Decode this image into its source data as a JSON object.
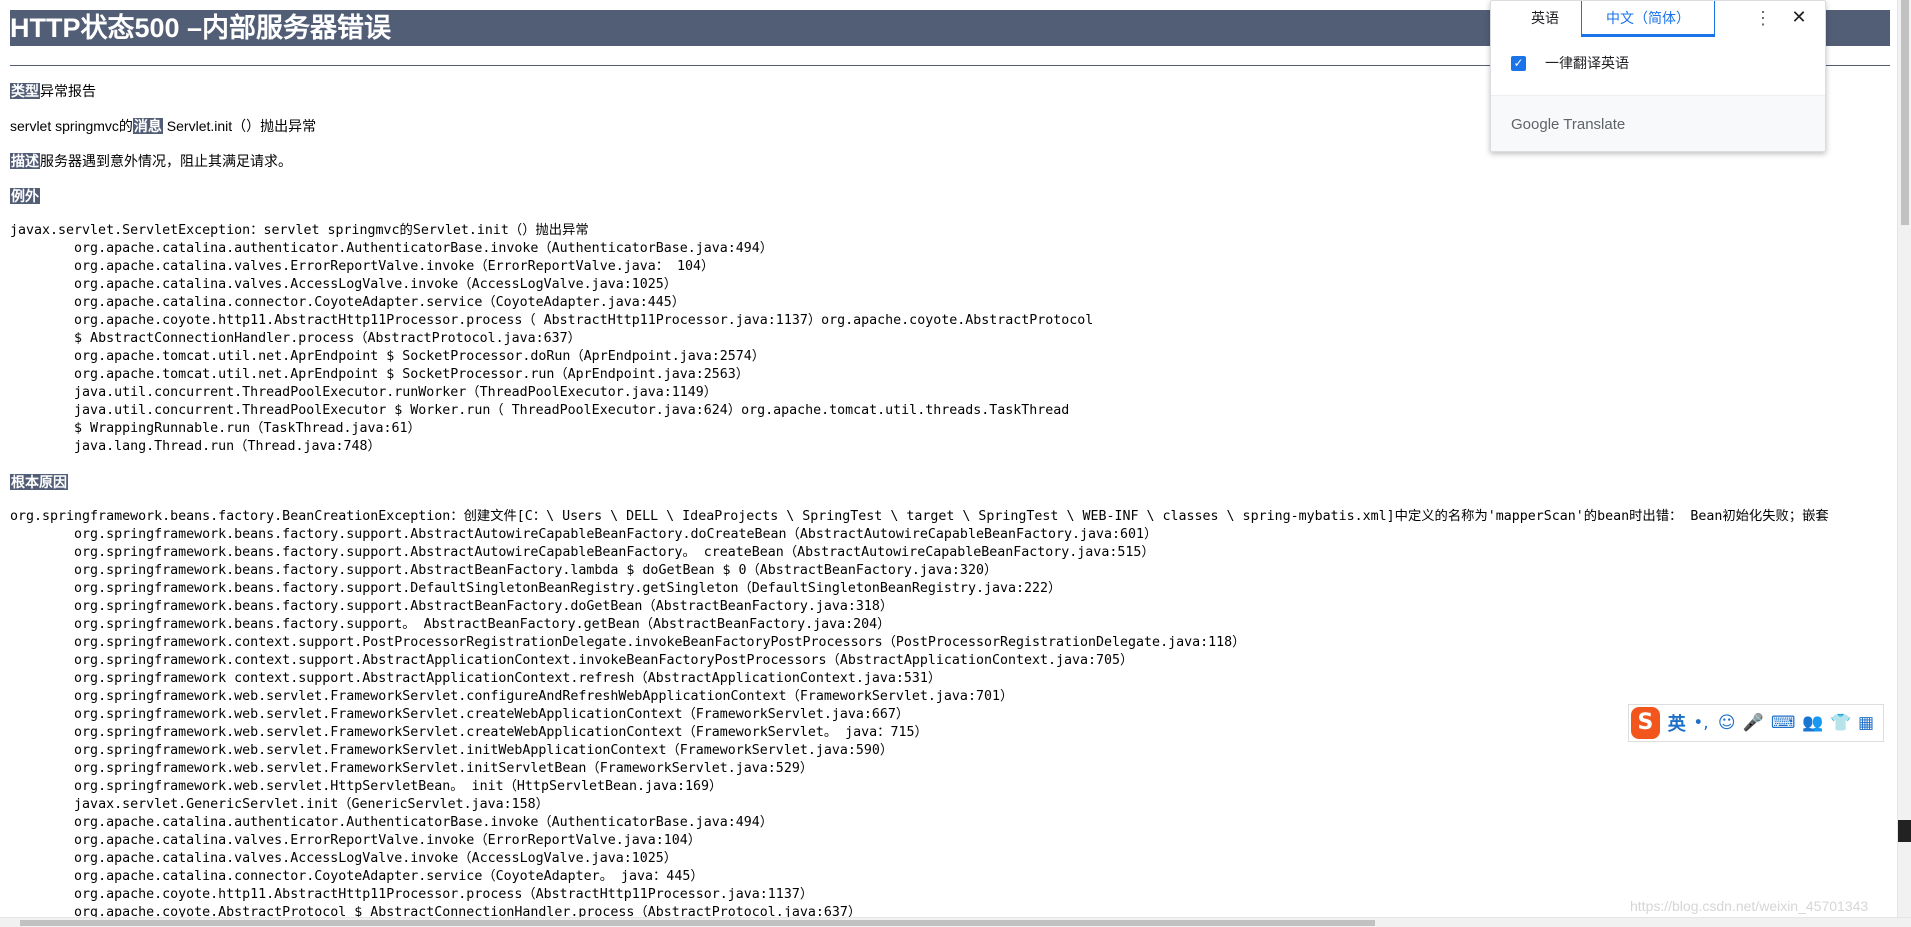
{
  "title": "HTTP状态500 –内部服务器错误",
  "type_label": "类型",
  "type_value": "异常报告",
  "message_prefix": "servlet springmvc的",
  "message_label": "消息",
  "message_value": " Servlet.init（）抛出异常",
  "description_label": "描述",
  "description_value": "服务器遇到意外情况，阻止其满足请求。",
  "exception_heading": "例外",
  "exception_trace": "javax.servlet.ServletException：servlet springmvc的Servlet.init（）抛出异常\n\torg.apache.catalina.authenticator.AuthenticatorBase.invoke（AuthenticatorBase.java:494）\n\torg.apache.catalina.valves.ErrorReportValve.invoke（ErrorReportValve.java： 104）\n\torg.apache.catalina.valves.AccessLogValve.invoke（AccessLogValve.java:1025）\n\torg.apache.catalina.connector.CoyoteAdapter.service（CoyoteAdapter.java:445）\n\torg.apache.coyote.http11.AbstractHttp11Processor.process（ AbstractHttp11Processor.java:1137）org.apache.coyote.AbstractProtocol\n\t$ AbstractConnectionHandler.process（AbstractProtocol.java:637）\n\torg.apache.tomcat.util.net.AprEndpoint $ SocketProcessor.doRun（AprEndpoint.java:2574）\n\torg.apache.tomcat.util.net.AprEndpoint $ SocketProcessor.run（AprEndpoint.java:2563）\n\tjava.util.concurrent.ThreadPoolExecutor.runWorker（ThreadPoolExecutor.java:1149）\n\tjava.util.concurrent.ThreadPoolExecutor $ Worker.run（ ThreadPoolExecutor.java:624）org.apache.tomcat.util.threads.TaskThread\n\t$ WrappingRunnable.run（TaskThread.java:61）\n\tjava.lang.Thread.run（Thread.java:748）",
  "root_cause_heading": "根本原因",
  "root_cause_trace": "org.springframework.beans.factory.BeanCreationException：创建文件[C：\\ Users \\ DELL \\ IdeaProjects \\ SpringTest \\ target \\ SpringTest \\ WEB-INF \\ classes \\ spring-mybatis.xml]中定义的名称为'mapperScan'的bean时出错： Bean初始化失败；嵌套\n\torg.springframework.beans.factory.support.AbstractAutowireCapableBeanFactory.doCreateBean（AbstractAutowireCapableBeanFactory.java:601）\n\torg.springframework.beans.factory.support.AbstractAutowireCapableBeanFactory。 createBean（AbstractAutowireCapableBeanFactory.java:515）\n\torg.springframework.beans.factory.support.AbstractBeanFactory.lambda $ doGetBean $ 0（AbstractBeanFactory.java:320）\n\torg.springframework.beans.factory.support.DefaultSingletonBeanRegistry.getSingleton（DefaultSingletonBeanRegistry.java:222）\n\torg.springframework.beans.factory.support.AbstractBeanFactory.doGetBean（AbstractBeanFactory.java:318）\n\torg.springframework.beans.factory.support。 AbstractBeanFactory.getBean（AbstractBeanFactory.java:204）\n\torg.springframework.context.support.PostProcessorRegistrationDelegate.invokeBeanFactoryPostProcessors（PostProcessorRegistrationDelegate.java:118）\n\torg.springframework.context.support.AbstractApplicationContext.invokeBeanFactoryPostProcessors（AbstractApplicationContext.java:705）\n\torg.springframework context.support.AbstractApplicationContext.refresh（AbstractApplicationContext.java:531）\n\torg.springframework.web.servlet.FrameworkServlet.configureAndRefreshWebApplicationContext（FrameworkServlet.java:701）\n\torg.springframework.web.servlet.FrameworkServlet.createWebApplicationContext（FrameworkServlet.java:667）\n\torg.springframework.web.servlet.FrameworkServlet.createWebApplicationContext（FrameworkServlet。 java：715）\n\torg.springframework.web.servlet.FrameworkServlet.initWebApplicationContext（FrameworkServlet.java:590）\n\torg.springframework.web.servlet.FrameworkServlet.initServletBean（FrameworkServlet.java:529）\n\torg.springframework.web.servlet.HttpServletBean。 init（HttpServletBean.java:169）\n\tjavax.servlet.GenericServlet.init（GenericServlet.java:158）\n\torg.apache.catalina.authenticator.AuthenticatorBase.invoke（AuthenticatorBase.java:494）\n\torg.apache.catalina.valves.ErrorReportValve.invoke（ErrorReportValve.java:104）\n\torg.apache.catalina.valves.AccessLogValve.invoke（AccessLogValve.java:1025）\n\torg.apache.catalina.connector.CoyoteAdapter.service（CoyoteAdapter。 java：445）\n\torg.apache.coyote.http11.AbstractHttp11Processor.process（AbstractHttp11Processor.java:1137）\n\torg.apache.coyote.AbstractProtocol $ AbstractConnectionHandler.process（AbstractProtocol.java:637）",
  "translate": {
    "tab_source": "英语",
    "tab_target": "中文（简体）",
    "always_translate": "一律翻译英语",
    "brand_google": "Google",
    "brand_translate": " Translate",
    "more_icon": "more-vert",
    "close_icon": "close",
    "accent": "#1a73e8"
  },
  "ime": {
    "logo": "S",
    "mode": "英",
    "items": [
      "•,",
      "☺",
      "🎤",
      "⌨",
      "👥",
      "👕",
      "▦"
    ]
  },
  "watermark": "https://blog.csdn.net/weixin_45701343"
}
